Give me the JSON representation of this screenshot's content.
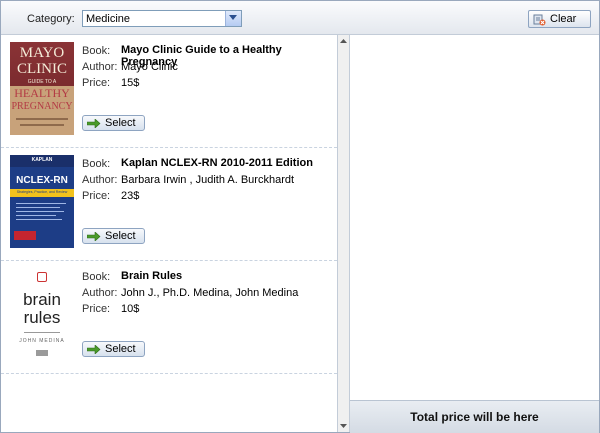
{
  "toolbar": {
    "category_label": "Category:",
    "category_value": "Medicine",
    "clear_label": "Clear"
  },
  "books": [
    {
      "book_label": "Book:",
      "title": "Mayo Clinic Guide to a Healthy Pregnancy",
      "author_label": "Author:",
      "author": "Mayo Clinic",
      "price_label": "Price:",
      "price": "15$",
      "select_label": "Select",
      "cover_text": {
        "line1": "MAYO",
        "line2": "CLINIC",
        "line3": "GUIDE TO A",
        "line4": "HEALTHY",
        "line5": "PREGNANCY"
      }
    },
    {
      "book_label": "Book:",
      "title": "Kaplan NCLEX-RN 2010-2011 Edition",
      "author_label": "Author:",
      "author": "Barbara Irwin , Judith A. Burckhardt",
      "price_label": "Price:",
      "price": "23$",
      "select_label": "Select",
      "cover_text": {
        "line1": "KAPLAN",
        "line2": "NCLEX-RN",
        "line3": "Strategies, Practice, and Review"
      }
    },
    {
      "book_label": "Book:",
      "title": "Brain Rules",
      "author_label": "Author:",
      "author": "John J., Ph.D. Medina, John Medina",
      "price_label": "Price:",
      "price": "10$",
      "select_label": "Select",
      "cover_text": {
        "line1": "brain",
        "line2": "rules",
        "line3": "JOHN MEDINA"
      }
    }
  ],
  "summary": {
    "total_label": "Total price will be here"
  },
  "colors": {
    "accent": "#7f9db9",
    "select_arrow": "#4a9a2a"
  }
}
